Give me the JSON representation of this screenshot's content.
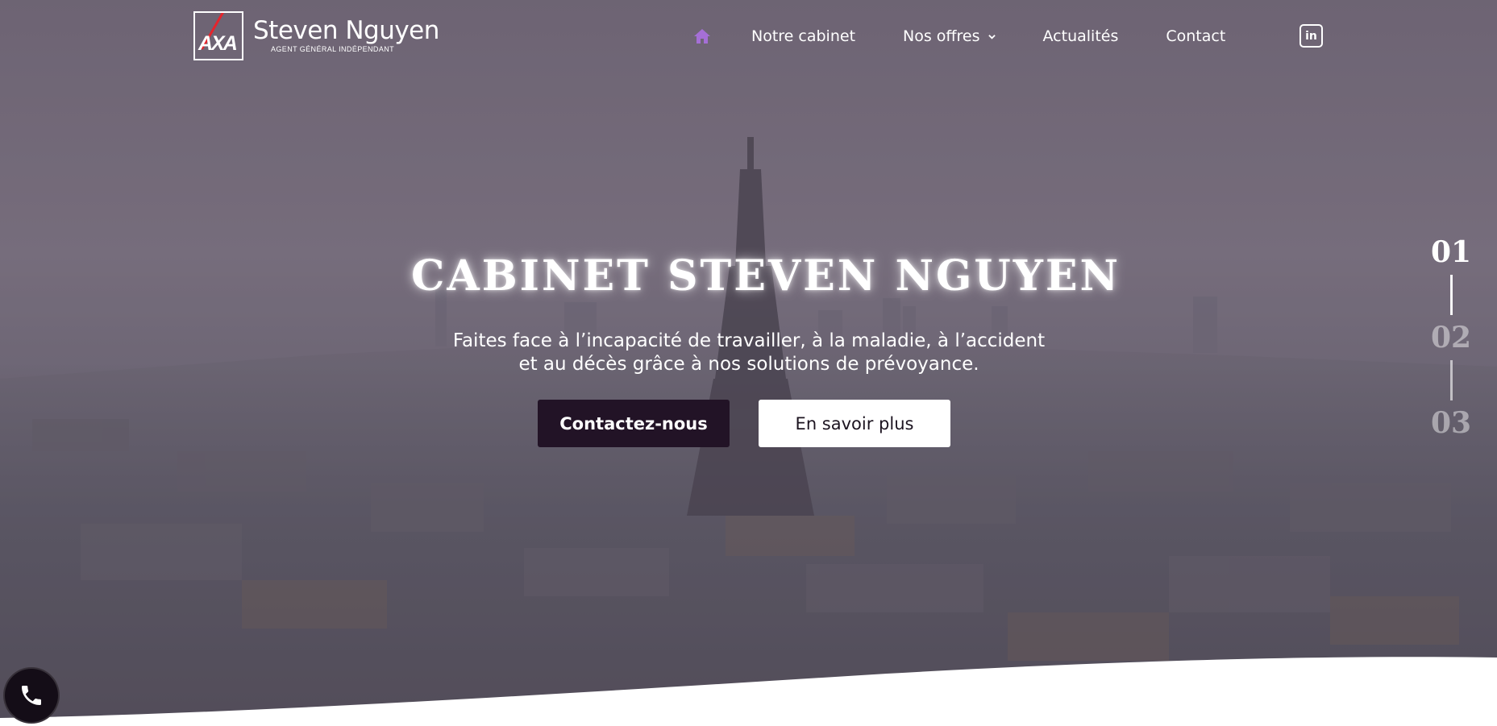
{
  "brand": {
    "logo_mark": "AXA",
    "name": "Steven Nguyen",
    "tagline": "AGENT GÉNÉRAL INDÉPENDANT"
  },
  "nav": {
    "home_icon": "home-icon",
    "items": [
      {
        "label": "Notre cabinet"
      },
      {
        "label": "Nos offres",
        "has_dropdown": true
      },
      {
        "label": "Actualités"
      },
      {
        "label": "Contact"
      }
    ],
    "social_icon": "linkedin-icon",
    "social_label": "in"
  },
  "hero": {
    "title": "CABINET STEVEN NGUYEN",
    "subtitle_line1": "Faites face à l’incapacité de travailler, à la maladie, à l’accident",
    "subtitle_line2": "et au décès grâce à nos solutions de prévoyance.",
    "primary_button": "Contactez-nous",
    "secondary_button": "En savoir plus"
  },
  "slider": {
    "slides": [
      "01",
      "02",
      "03"
    ],
    "active": "01"
  },
  "floating": {
    "phone_icon": "phone-icon"
  },
  "colors": {
    "accent": "#a56fd6",
    "dark_button": "#221326",
    "overlay": "#6c6270"
  }
}
